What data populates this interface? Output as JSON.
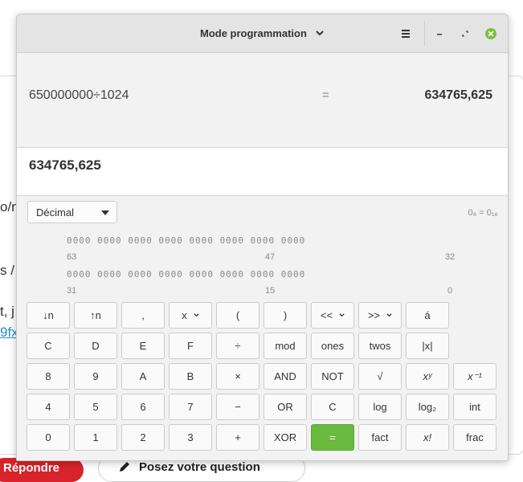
{
  "background": {
    "fragments": [
      "o/n",
      "s /",
      "t, j",
      "9fx"
    ],
    "reply_button": "Répondre",
    "ask_button": "Posez votre question"
  },
  "window": {
    "title": "Mode programmation",
    "controls": [
      "menu-icon",
      "minimize-icon",
      "maximize-icon",
      "close-icon"
    ]
  },
  "display": {
    "expression": "650000000÷1024",
    "equals": "=",
    "result": "634765,625",
    "entry": "634765,625"
  },
  "mode": {
    "selected": "Décimal",
    "conversion": "0₈ = 0₁₆"
  },
  "bits": {
    "row1": "0000  0000  0000  0000  0000  0000  0000  0000",
    "row1_labels": [
      "63",
      "47",
      "32"
    ],
    "row2": "0000  0000  0000  0000  0000  0000  0000  0000",
    "row2_labels": [
      "31",
      "15",
      "0"
    ]
  },
  "keys": [
    [
      "↓n",
      "↑n",
      ",",
      "x",
      "(",
      ")",
      "<<",
      ">>",
      "á"
    ],
    [
      "C",
      "D",
      "E",
      "F",
      "÷",
      "mod",
      "ones",
      "twos",
      "|x|"
    ],
    [
      "8",
      "9",
      "A",
      "B",
      "×",
      "AND",
      "NOT",
      "√",
      "xʸ",
      "x⁻¹"
    ],
    [
      "4",
      "5",
      "6",
      "7",
      "−",
      "OR",
      "C",
      "log",
      "log₂",
      "int"
    ],
    [
      "0",
      "1",
      "2",
      "3",
      "+",
      "XOR",
      "=",
      "fact",
      "x!",
      "frac"
    ]
  ],
  "colors": {
    "equals_key": "#6aba3f",
    "close_button": "#7cbe3e"
  }
}
